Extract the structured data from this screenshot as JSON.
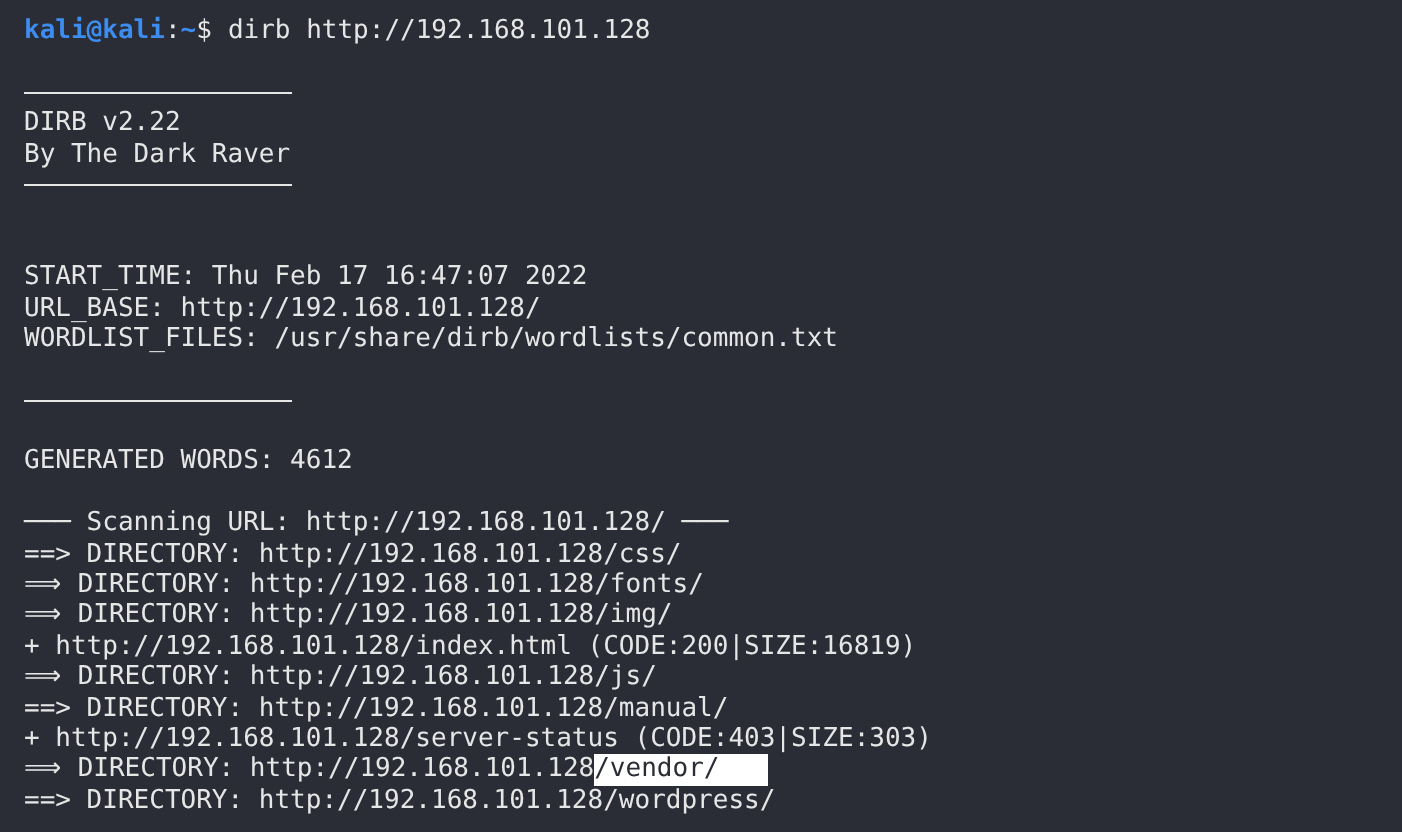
{
  "terminal": {
    "prompt": {
      "user": "kali@kali",
      "separator": ":",
      "path": "~",
      "symbol": "$",
      "command": "dirb http://192.168.101.128"
    },
    "lines": [
      {
        "kind": "blank"
      },
      {
        "kind": "rule"
      },
      {
        "kind": "text",
        "text": "DIRB v2.22"
      },
      {
        "kind": "text",
        "text": "By The Dark Raver"
      },
      {
        "kind": "rule"
      },
      {
        "kind": "blank"
      },
      {
        "kind": "blank"
      },
      {
        "kind": "text",
        "text": "START_TIME: Thu Feb 17 16:47:07 2022"
      },
      {
        "kind": "text",
        "text": "URL_BASE: http://192.168.101.128/"
      },
      {
        "kind": "text",
        "text": "WORDLIST_FILES: /usr/share/dirb/wordlists/common.txt"
      },
      {
        "kind": "blank"
      },
      {
        "kind": "rule"
      },
      {
        "kind": "blank"
      },
      {
        "kind": "text",
        "text": "GENERATED WORDS: 4612"
      },
      {
        "kind": "blank"
      },
      {
        "kind": "text",
        "text": "─── Scanning URL: http://192.168.101.128/ ───"
      },
      {
        "kind": "text",
        "text": "==> DIRECTORY: http://192.168.101.128/css/"
      },
      {
        "kind": "text",
        "text": "⟹ DIRECTORY: http://192.168.101.128/fonts/"
      },
      {
        "kind": "text",
        "text": "⟹ DIRECTORY: http://192.168.101.128/img/"
      },
      {
        "kind": "text",
        "text": "+ http://192.168.101.128/index.html (CODE:200|SIZE:16819)"
      },
      {
        "kind": "text",
        "text": "⟹ DIRECTORY: http://192.168.101.128/js/"
      },
      {
        "kind": "text",
        "text": "==> DIRECTORY: http://192.168.101.128/manual/"
      },
      {
        "kind": "text",
        "text": "+ http://192.168.101.128/server-status (CODE:403|SIZE:303)"
      },
      {
        "kind": "text",
        "text": "⟹ DIRECTORY: http://192.168.101.128",
        "selection": "/vendor/"
      },
      {
        "kind": "text",
        "text": "==> DIRECTORY: http://192.168.101.128/wordpress/"
      }
    ]
  }
}
